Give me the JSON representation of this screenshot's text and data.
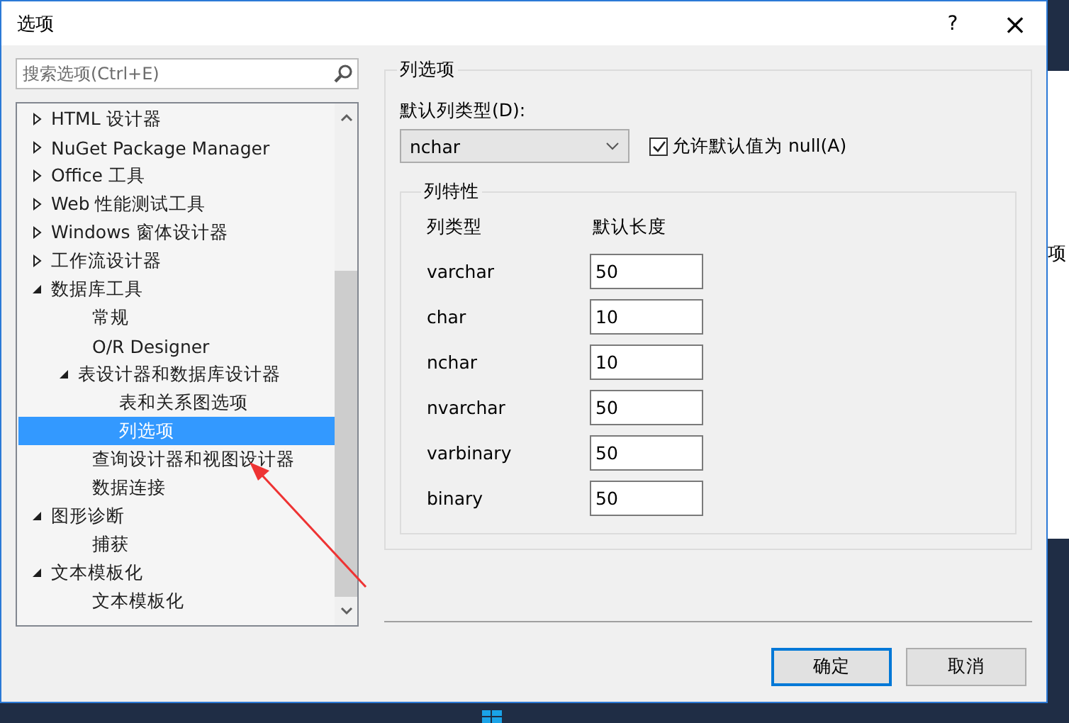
{
  "window": {
    "title": "选项",
    "help": "?",
    "close": "×"
  },
  "search": {
    "placeholder": "搜索选项(Ctrl+E)"
  },
  "tree": [
    {
      "label": "HTML 设计器",
      "expanded": false,
      "selected": false
    },
    {
      "label": "NuGet Package Manager",
      "expanded": false,
      "selected": false
    },
    {
      "label": "Office 工具",
      "expanded": false,
      "selected": false
    },
    {
      "label": "Web 性能测试工具",
      "expanded": false,
      "selected": false
    },
    {
      "label": "Windows 窗体设计器",
      "expanded": false,
      "selected": false
    },
    {
      "label": "工作流设计器",
      "expanded": false,
      "selected": false
    },
    {
      "label": "数据库工具",
      "expanded": true,
      "selected": false,
      "children": [
        {
          "label": "常规",
          "selected": false
        },
        {
          "label": "O/R Designer",
          "selected": false
        },
        {
          "label": "表设计器和数据库设计器",
          "expanded": true,
          "selected": false,
          "children": [
            {
              "label": "表和关系图选项",
              "selected": false
            },
            {
              "label": "列选项",
              "selected": true
            }
          ]
        },
        {
          "label": "查询设计器和视图设计器",
          "selected": false
        },
        {
          "label": "数据连接",
          "selected": false
        }
      ]
    },
    {
      "label": "图形诊断",
      "expanded": true,
      "selected": false,
      "children": [
        {
          "label": "捕获",
          "selected": false
        }
      ]
    },
    {
      "label": "文本模板化",
      "expanded": true,
      "selected": false,
      "children": [
        {
          "label": "文本模板化",
          "selected": false
        }
      ]
    }
  ],
  "panel": {
    "title": "列选项",
    "default_type_label": "默认列类型(D):",
    "default_type": "nchar",
    "allow_null": {
      "label": "允许默认值为 null(A)",
      "checked": true
    },
    "properties": {
      "title": "列特性",
      "columns": [
        "列类型",
        "默认长度"
      ],
      "rows": [
        {
          "type": "varchar",
          "length": "50"
        },
        {
          "type": "char",
          "length": "10"
        },
        {
          "type": "nchar",
          "length": "10"
        },
        {
          "type": "nvarchar",
          "length": "50"
        },
        {
          "type": "varbinary",
          "length": "50"
        },
        {
          "type": "binary",
          "length": "50"
        }
      ]
    }
  },
  "buttons": [
    {
      "label": "确定",
      "default": true
    },
    {
      "label": "取消",
      "default": false
    }
  ],
  "background": {
    "side_text": "项"
  }
}
